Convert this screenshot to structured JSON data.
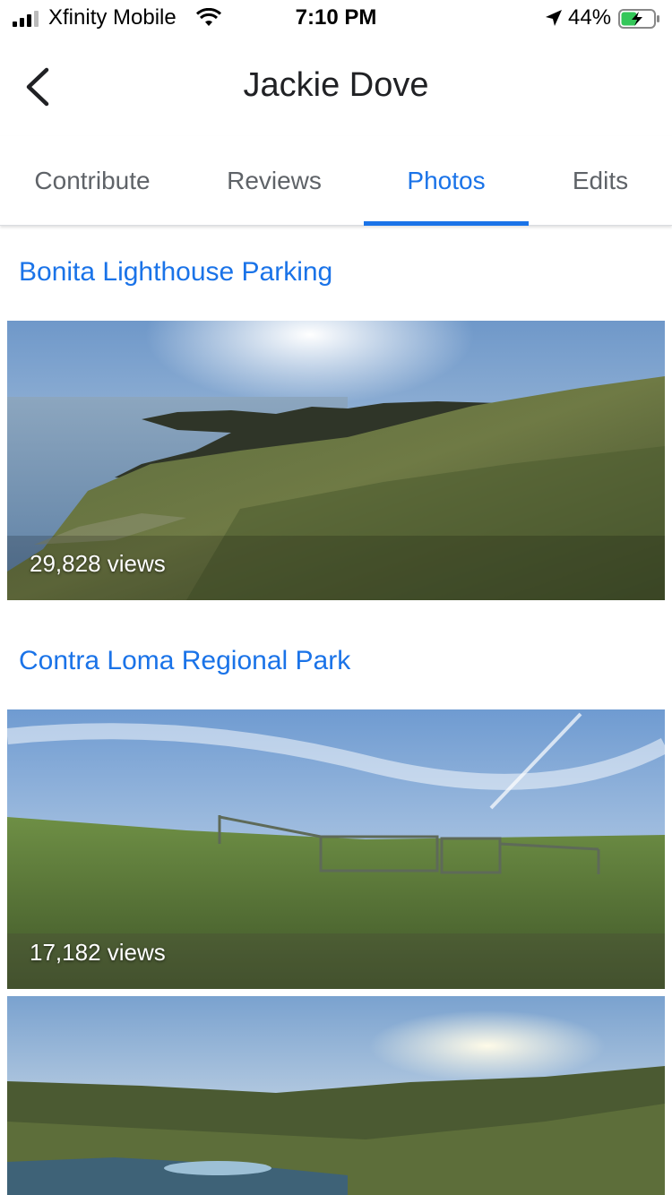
{
  "status_bar": {
    "carrier": "Xfinity Mobile",
    "time": "7:10 PM",
    "battery_percent": "44%"
  },
  "header": {
    "title": "Jackie Dove"
  },
  "tabs": [
    {
      "label": "Contribute"
    },
    {
      "label": "Reviews"
    },
    {
      "label": "Photos"
    },
    {
      "label": "Edits"
    }
  ],
  "active_tab": "Photos",
  "places": [
    {
      "name": "Bonita Lighthouse Parking",
      "photo_views": "29,828 views"
    },
    {
      "name": "Contra Loma Regional Park",
      "photo_views": "17,182 views"
    }
  ],
  "colors": {
    "accent": "#1a73e8",
    "tab_inactive": "#5f6368",
    "title": "#202124"
  }
}
